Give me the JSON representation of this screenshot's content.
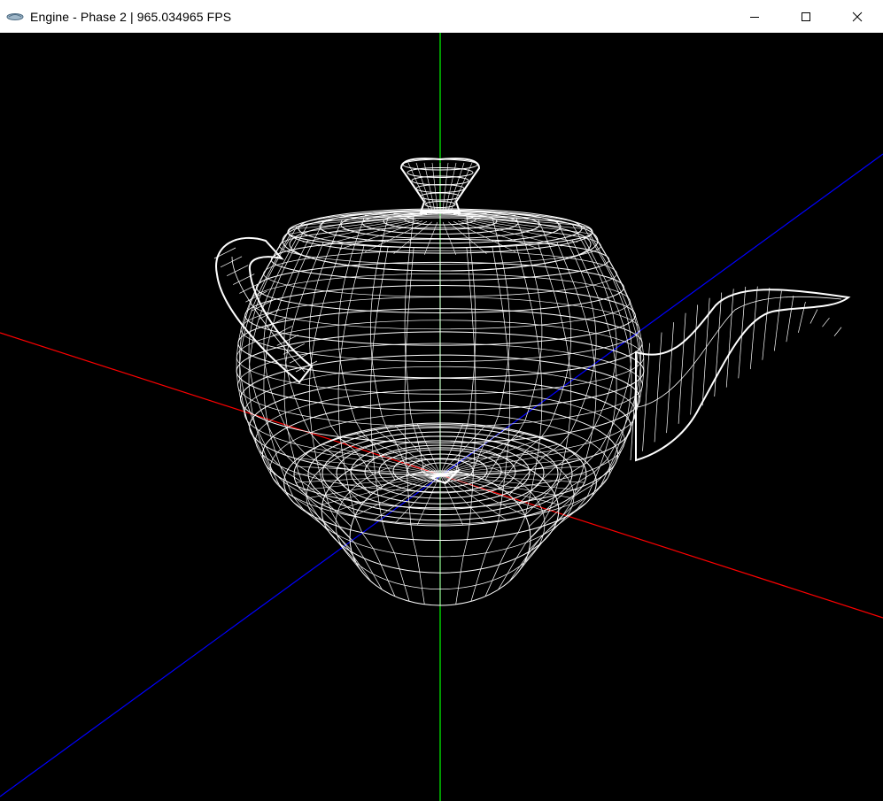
{
  "window": {
    "title": "Engine - Phase 2 | 965.034965 FPS",
    "app_icon": "engine-logo-icon",
    "controls": [
      {
        "name": "minimize",
        "icon": "minimize-icon"
      },
      {
        "name": "maximize",
        "icon": "maximize-icon"
      },
      {
        "name": "close",
        "icon": "close-icon"
      }
    ]
  },
  "viewport": {
    "background": "#000000",
    "model": "teapot",
    "render_mode": "wireframe",
    "wire_color": "#ffffff",
    "axes": {
      "x_color": "#ff0000",
      "y_color": "#00ff00",
      "z_color": "#0000ff"
    }
  }
}
